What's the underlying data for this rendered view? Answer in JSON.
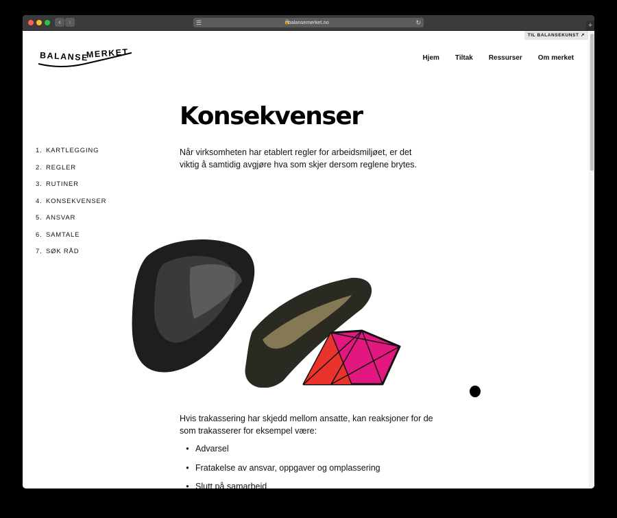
{
  "browser": {
    "url": "balansemerket.no",
    "lock": "🔒",
    "back": "‹",
    "forward": "›",
    "reader": "☰",
    "reload": "↻",
    "newtab": "+"
  },
  "top_link": "TIL BALANSEKUNST ↗",
  "logo": {
    "left": "BALANSE",
    "right": "MERKET"
  },
  "nav": [
    "Hjem",
    "Tiltak",
    "Ressurser",
    "Om merket"
  ],
  "sidenav": [
    {
      "num": "1.",
      "label": "KARTLEGGING"
    },
    {
      "num": "2.",
      "label": "REGLER"
    },
    {
      "num": "3.",
      "label": "RUTINER"
    },
    {
      "num": "4.",
      "label": "KONSEKVENSER"
    },
    {
      "num": "5.",
      "label": "ANSVAR"
    },
    {
      "num": "6.",
      "label": "SAMTALE"
    },
    {
      "num": "7.",
      "label": "SØK RÅD"
    }
  ],
  "title": "Konsekvenser",
  "intro": "Når virksomheten har etablert regler for arbeidsmiljøet, er det viktig å samtidig avgjøre hva som skjer dersom reglene brytes.",
  "para2": "Hvis trakassering har skjedd mellom ansatte, kan reaksjoner for de som trakasserer for eksempel være:",
  "bullet_char": "•",
  "bullets": [
    "Advarsel",
    "Fratakelse av ansvar, oppgaver og omplassering",
    "Slutt på samarbeid"
  ],
  "colors": {
    "brand": "#000000",
    "accent_pink": "#e2177f",
    "accent_red": "#e9332c"
  }
}
